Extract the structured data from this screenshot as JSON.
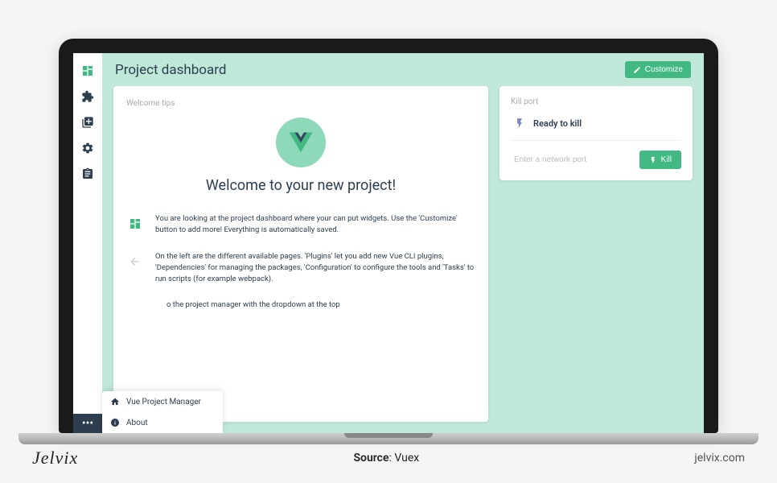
{
  "header": {
    "title": "Project dashboard",
    "customize_label": "Customize"
  },
  "welcome": {
    "card_title": "Welcome tips",
    "heading": "Welcome to your new project!",
    "tips": [
      "You are looking at the project dashboard where your can put widgets. Use the 'Customize' button to add more! Everything is automatically saved.",
      "On the left are the different available pages. 'Plugins' let you add new Vue CLI plugins, 'Dependencies' for managing the packages, 'Configuration' to configure the tools and 'Tasks' to run scripts (for example webpack).",
      "o the project manager with the dropdown at the top"
    ]
  },
  "kill": {
    "card_title": "Kill port",
    "status": "Ready to kill",
    "placeholder": "Enter a network port",
    "button_label": "Kill"
  },
  "popup": {
    "items": [
      {
        "icon": "home-icon",
        "label": "Vue Project Manager"
      },
      {
        "icon": "info-icon",
        "label": "About"
      }
    ]
  },
  "sidebar": {
    "icons": [
      "dashboard-icon",
      "puzzle-icon",
      "folder-icon",
      "gear-icon",
      "clipboard-icon"
    ]
  },
  "caption": {
    "logo": "Jelvix",
    "source_label": "Source",
    "source_value": "Vuex",
    "url": "jelvix.com"
  }
}
